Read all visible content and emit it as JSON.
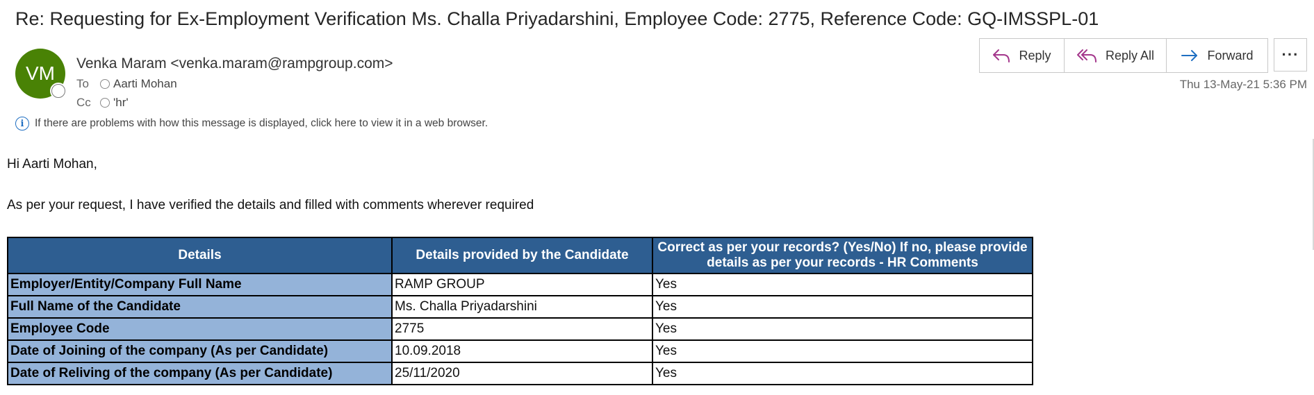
{
  "email": {
    "subject": "Re: Requesting for Ex-Employment Verification Ms. Challa Priyadarshini, Employee Code: 2775, Reference Code: GQ-IMSSPL-01",
    "avatar_initials": "VM",
    "avatar_color": "#498205",
    "sender": "Venka Maram <venka.maram@rampgroup.com>",
    "to_label": "To",
    "to": "Aarti Mohan",
    "cc_label": "Cc",
    "cc": "'hr'",
    "timestamp": "Thu 13-May-21 5:36 PM",
    "info_bar": "If there are problems with how this message is displayed, click here to view it in a web browser."
  },
  "actions": {
    "reply": "Reply",
    "reply_all": "Reply All",
    "forward": "Forward",
    "more": "···",
    "accent_color": "#a4378c",
    "forward_color": "#1f6fc2"
  },
  "body": {
    "greeting": "Hi Aarti Mohan,",
    "line1": "As per your request, I have verified the details and filled with comments wherever required"
  },
  "table": {
    "headers": [
      "Details",
      "Details provided by the Candidate",
      "Correct as per your records? (Yes/No) If no, please provide details as per your records - HR Comments"
    ],
    "rows": [
      {
        "detail": "Employer/Entity/Company Full Name",
        "candidate": "RAMP GROUP",
        "hr": "Yes"
      },
      {
        "detail": "Full Name of the Candidate",
        "candidate": "Ms. Challa Priyadarshini",
        "hr": "Yes"
      },
      {
        "detail": "Employee Code",
        "candidate": "2775",
        "hr": "Yes"
      },
      {
        "detail": "Date of Joining of the company (As per Candidate)",
        "candidate": "10.09.2018",
        "hr": "Yes"
      },
      {
        "detail": "Date of Reliving of the company (As per Candidate)",
        "candidate": "25/11/2020",
        "hr": "Yes"
      }
    ],
    "header_color": "#2e5e91",
    "key_color": "#94b3d9"
  }
}
